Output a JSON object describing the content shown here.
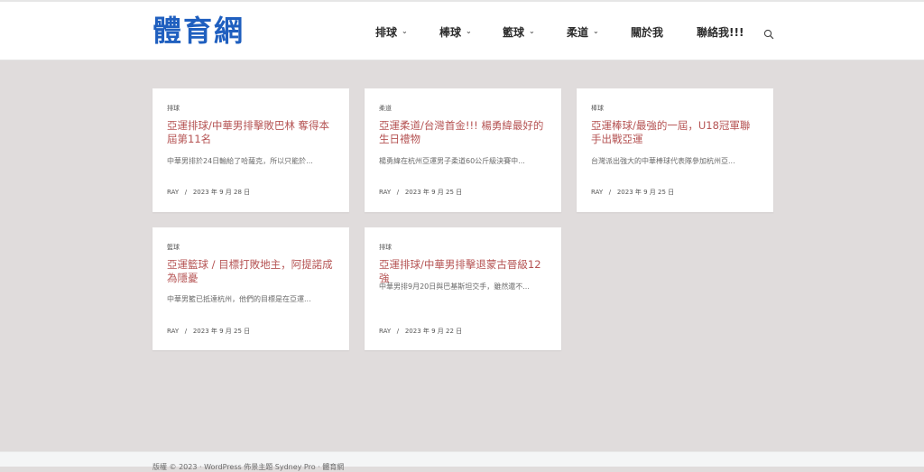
{
  "site": {
    "logo": "體育網"
  },
  "nav": {
    "items": [
      {
        "label": "排球",
        "has_dropdown": true
      },
      {
        "label": "棒球",
        "has_dropdown": true
      },
      {
        "label": "籃球",
        "has_dropdown": true
      },
      {
        "label": "柔道",
        "has_dropdown": true
      },
      {
        "label": "關於我",
        "has_dropdown": false
      },
      {
        "label": "聯絡我!!!",
        "has_dropdown": false
      }
    ],
    "search_icon": "search-icon"
  },
  "posts": [
    {
      "category": "排球",
      "title": "亞運排球/中華男排擊敗巴林 奪得本屆第11名",
      "excerpt": "中華男排於24日輸給了哈薩克，所以只能於...",
      "author": "RAY",
      "date": "2023 年 9 月 28 日"
    },
    {
      "category": "柔道",
      "title": "亞運柔道/台灣首金!!! 楊勇緯最好的生日禮物",
      "excerpt": "楊勇緯在杭州亞運男子柔道60公斤級決賽中...",
      "author": "RAY",
      "date": "2023 年 9 月 25 日"
    },
    {
      "category": "棒球",
      "title": "亞運棒球/最強的一屆，U18冠軍聯手出戰亞運",
      "excerpt": "台灣派出強大的中華棒球代表隊參加杭州亞...",
      "author": "RAY",
      "date": "2023 年 9 月 25 日"
    },
    {
      "category": "籃球",
      "title": "亞運籃球 / 目標打敗地主，阿提諾成為隱憂",
      "excerpt": "中華男籃已抵達杭州，他們的目標是在亞運...",
      "author": "RAY",
      "date": "2023 年 9 月 25 日"
    },
    {
      "category": "排球",
      "title": "亞運排球/中華男排擊退蒙古晉級12強",
      "excerpt": "中華男排9月20日與巴基斯坦交手，雖然還不...",
      "author": "RAY",
      "date": "2023 年 9 月 22 日"
    }
  ],
  "footer": {
    "text": "版權 © 2023 · WordPress 佈景主題 Sydney Pro · 體育網"
  },
  "colors": {
    "logo": "#1f5fbf",
    "post_title": "#b55353",
    "background": "#e0dcdc"
  }
}
